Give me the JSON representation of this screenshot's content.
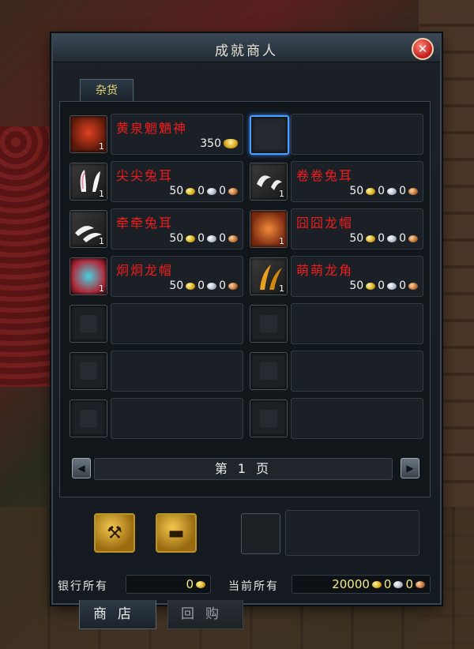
{
  "window": {
    "title": "成就商人",
    "close_icon": "close-icon"
  },
  "tabs": {
    "category": "杂货"
  },
  "items": [
    {
      "name": "黄泉魍魉神",
      "price": {
        "ingot": "350"
      },
      "qty": "1",
      "icon": "creature-icon"
    },
    {
      "name": "",
      "selected": true
    },
    {
      "name": "尖尖兔耳",
      "price": {
        "gold": "50",
        "silver": "0",
        "copper": "0"
      },
      "qty": "1",
      "icon": "rabbit-ears-icon"
    },
    {
      "name": "卷卷兔耳",
      "price": {
        "gold": "50",
        "silver": "0",
        "copper": "0"
      },
      "qty": "1",
      "icon": "rabbit-ears-icon"
    },
    {
      "name": "牵牵兔耳",
      "price": {
        "gold": "50",
        "silver": "0",
        "copper": "0"
      },
      "qty": "1",
      "icon": "rabbit-ears-icon"
    },
    {
      "name": "囧囧龙帽",
      "price": {
        "gold": "50",
        "silver": "0",
        "copper": "0"
      },
      "qty": "1",
      "icon": "dragon-hat-icon"
    },
    {
      "name": "炯炯龙帽",
      "price": {
        "gold": "50",
        "silver": "0",
        "copper": "0"
      },
      "qty": "1",
      "icon": "dragon-hat-icon"
    },
    {
      "name": "萌萌龙角",
      "price": {
        "gold": "50",
        "silver": "0",
        "copper": "0"
      },
      "qty": "1",
      "icon": "dragon-horn-icon"
    }
  ],
  "pager": {
    "label": "第 1 页"
  },
  "money": {
    "bank_label": "银行所有",
    "bank_value": "0",
    "current_label": "当前所有",
    "current_gold": "20000",
    "current_silver": "0",
    "current_copper": "0"
  },
  "bottom_tabs": {
    "shop": "商店",
    "buyback": "回购"
  },
  "colors": {
    "item_name": "#ee1d1d",
    "selected_border": "#4aa0ff",
    "title": "#e8e4d6"
  }
}
